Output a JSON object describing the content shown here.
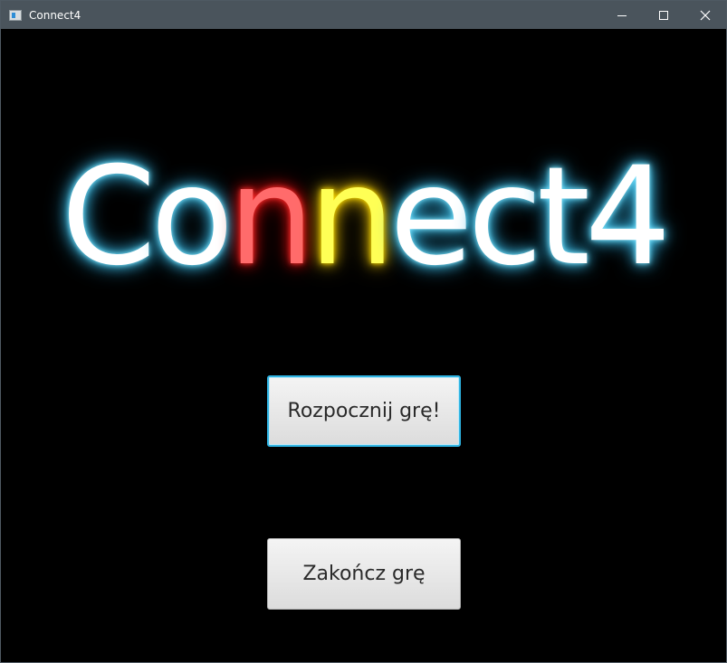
{
  "window": {
    "title": "Connect4",
    "controls": {
      "minimize_icon": "minimize-icon",
      "maximize_icon": "maximize-icon",
      "close_icon": "close-icon"
    }
  },
  "logo": {
    "letters": [
      {
        "char": "C",
        "color": "#ffffff",
        "glow": "#48c8f0"
      },
      {
        "char": "o",
        "color": "#ffffff",
        "glow": "#48c8f0"
      },
      {
        "char": "n",
        "color": "#ff6b6b",
        "glow": "#e01818"
      },
      {
        "char": "n",
        "color": "#ffff55",
        "glow": "#e8c000"
      },
      {
        "char": "e",
        "color": "#ffffff",
        "glow": "#48c8f0"
      },
      {
        "char": "c",
        "color": "#ffffff",
        "glow": "#48c8f0"
      },
      {
        "char": "t",
        "color": "#ffffff",
        "glow": "#48c8f0"
      },
      {
        "char": "4",
        "color": "#ffffff",
        "glow": "#48c8f0"
      }
    ]
  },
  "menu": {
    "start_label": "Rozpocznij grę!",
    "quit_label": "Zakończ grę"
  },
  "colors": {
    "background": "#000000",
    "titlebar": "#4a545c",
    "focus_border": "#2fb4e3"
  }
}
